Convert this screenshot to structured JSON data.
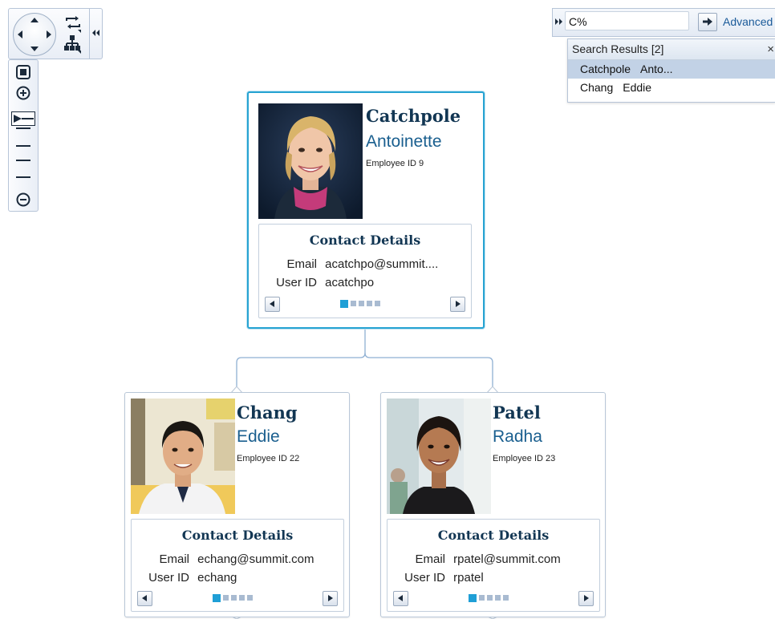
{
  "navigation": {
    "pan_up": "pan-up-arrow",
    "pan_down": "pan-down-arrow",
    "pan_left": "pan-left-arrow",
    "pan_right": "pan-right-arrow",
    "rotate": "rotate-orientation-icon",
    "layout": "hierarchy-layout-icon",
    "collapse": "collapse-left-icon"
  },
  "zoom": {
    "fit": "fit-to-screen-icon",
    "zoom_in": "zoom-in-icon",
    "zoom_out": "zoom-out-icon",
    "level_index": 0,
    "level_count": 5
  },
  "search": {
    "value": "C%",
    "advanced_label": "Advanced",
    "results_title": "Search Results [2]",
    "close_glyph": "×",
    "results": [
      {
        "last": "Catchpole",
        "first": "Anto...",
        "selected": true
      },
      {
        "last": "Chang",
        "first": "Eddie",
        "selected": false
      }
    ]
  },
  "cards": [
    {
      "last": "Catchpole",
      "first": "Antoinette",
      "employee_id": "Employee ID  9",
      "contact_title": "Contact Details",
      "email_label": "Email",
      "email": "acatchpo@summit....",
      "userid_label": "User ID",
      "userid": "acatchpo",
      "page": 1,
      "pages": 5,
      "selected": true
    },
    {
      "last": "Chang",
      "first": "Eddie",
      "employee_id": "Employee ID  22",
      "contact_title": "Contact Details",
      "email_label": "Email",
      "email": "echang@summit.com",
      "userid_label": "User ID",
      "userid": "echang",
      "page": 1,
      "pages": 5,
      "selected": false
    },
    {
      "last": "Patel",
      "first": "Radha",
      "employee_id": "Employee ID  23",
      "contact_title": "Contact Details",
      "email_label": "Email",
      "email": "rpatel@summit.com",
      "userid_label": "User ID",
      "userid": "rpatel",
      "page": 1,
      "pages": 5,
      "selected": false
    }
  ],
  "colors": {
    "selected_border": "#27a3d2",
    "heading": "#123653",
    "first_name": "#1a5f8f",
    "dot_active": "#1f9fd6",
    "dot_inactive": "#a9bbd1",
    "connector": "#8fb0d3"
  }
}
